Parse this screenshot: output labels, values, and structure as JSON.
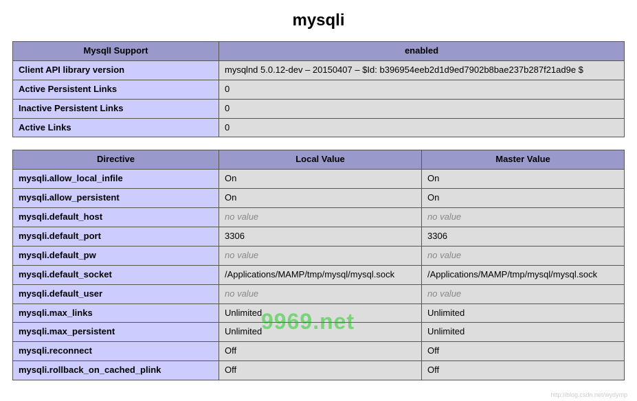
{
  "title": "mysqli",
  "table1": {
    "headers": [
      "MysqlI Support",
      "enabled"
    ],
    "rows": [
      {
        "key": "Client API library version",
        "value": "mysqlnd 5.0.12-dev – 20150407 – $Id: b396954eeb2d1d9ed7902b8bae237b287f21ad9e $"
      },
      {
        "key": "Active Persistent Links",
        "value": "0"
      },
      {
        "key": "Inactive Persistent Links",
        "value": "0"
      },
      {
        "key": "Active Links",
        "value": "0"
      }
    ]
  },
  "table2": {
    "headers": [
      "Directive",
      "Local Value",
      "Master Value"
    ],
    "rows": [
      {
        "key": "mysqli.allow_local_infile",
        "local": "On",
        "master": "On",
        "local_empty": false,
        "master_empty": false
      },
      {
        "key": "mysqli.allow_persistent",
        "local": "On",
        "master": "On",
        "local_empty": false,
        "master_empty": false
      },
      {
        "key": "mysqli.default_host",
        "local": "no value",
        "master": "no value",
        "local_empty": true,
        "master_empty": true
      },
      {
        "key": "mysqli.default_port",
        "local": "3306",
        "master": "3306",
        "local_empty": false,
        "master_empty": false
      },
      {
        "key": "mysqli.default_pw",
        "local": "no value",
        "master": "no value",
        "local_empty": true,
        "master_empty": true
      },
      {
        "key": "mysqli.default_socket",
        "local": "/Applications/MAMP/tmp/mysql/mysql.sock",
        "master": "/Applications/MAMP/tmp/mysql/mysql.sock",
        "local_empty": false,
        "master_empty": false
      },
      {
        "key": "mysqli.default_user",
        "local": "no value",
        "master": "no value",
        "local_empty": true,
        "master_empty": true
      },
      {
        "key": "mysqli.max_links",
        "local": "Unlimited",
        "master": "Unlimited",
        "local_empty": false,
        "master_empty": false
      },
      {
        "key": "mysqli.max_persistent",
        "local": "Unlimited",
        "master": "Unlimited",
        "local_empty": false,
        "master_empty": false
      },
      {
        "key": "mysqli.reconnect",
        "local": "Off",
        "master": "Off",
        "local_empty": false,
        "master_empty": false
      },
      {
        "key": "mysqli.rollback_on_cached_plink",
        "local": "Off",
        "master": "Off",
        "local_empty": false,
        "master_empty": false
      }
    ]
  },
  "watermark": "9969.net",
  "footer": "http://blog.csdn.net/wydymp"
}
